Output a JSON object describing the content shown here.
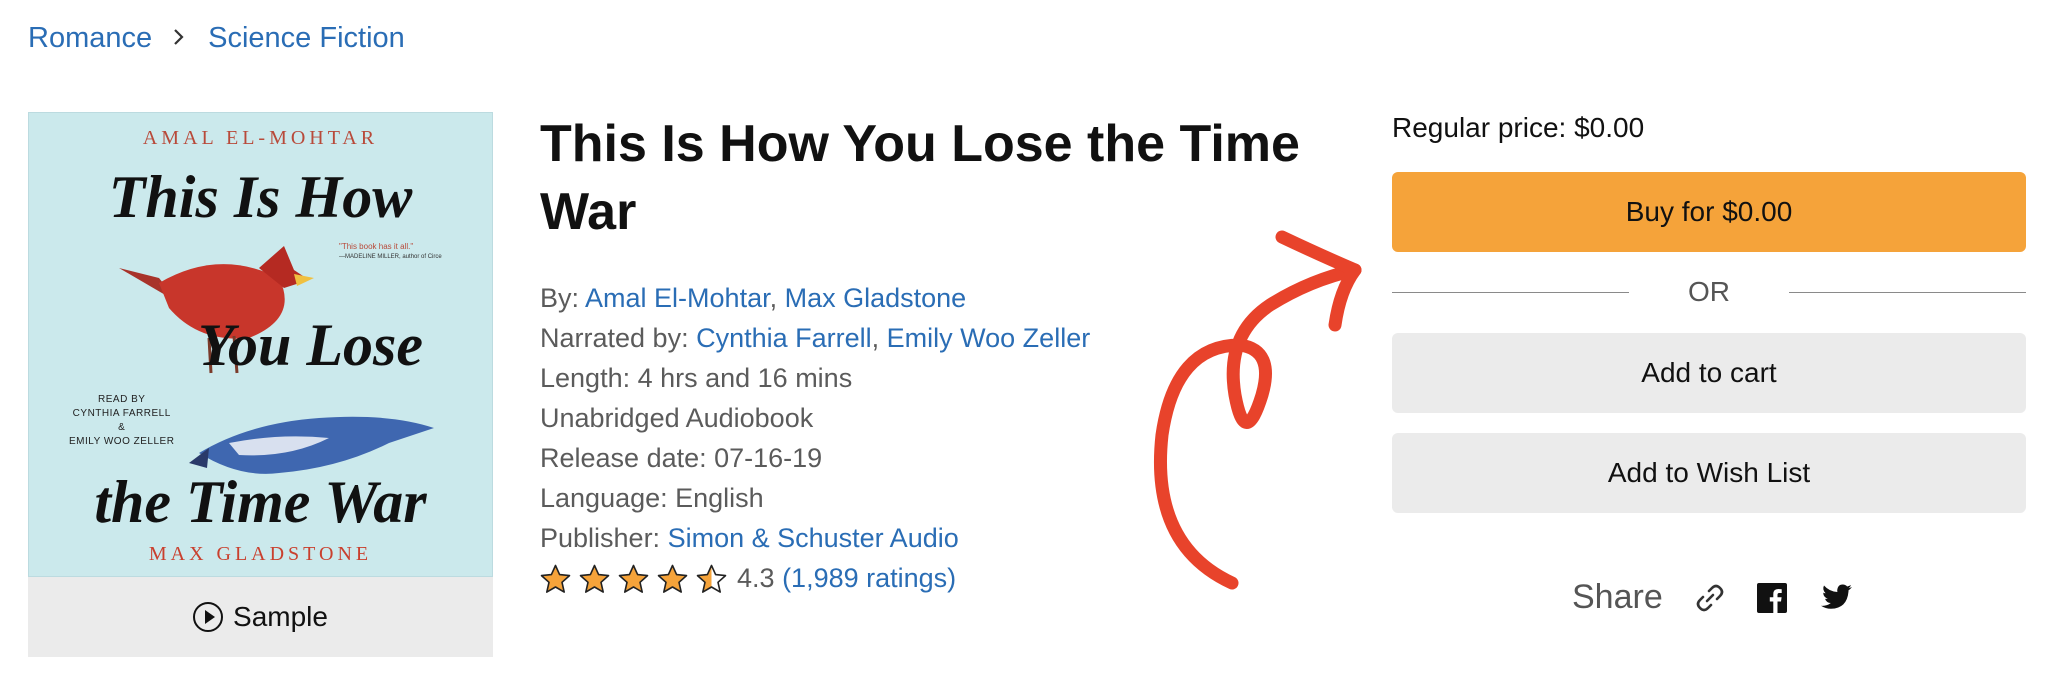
{
  "breadcrumb": {
    "items": [
      "Romance",
      "Science Fiction"
    ]
  },
  "cover": {
    "author_top": "AMAL EL-MOHTAR",
    "title_lines": [
      "This Is How",
      "You Lose",
      "the Time War"
    ],
    "read_by": "READ BY",
    "narrator_1": "CYNTHIA FARRELL",
    "amp": "&",
    "narrator_2": "EMILY WOO ZELLER",
    "quote": "\"This book has it all.\"",
    "quote_attrib": "—MADELINE MILLER, author of Circe",
    "author_bottom": "MAX GLADSTONE"
  },
  "sample": {
    "label": "Sample"
  },
  "book": {
    "title": "This Is How You Lose the Time War",
    "by_label": "By: ",
    "authors": [
      "Amal El-Mohtar",
      "Max Gladstone"
    ],
    "narrated_label": "Narrated by: ",
    "narrators": [
      "Cynthia Farrell",
      "Emily Woo Zeller"
    ],
    "length": "Length: 4 hrs and 16 mins",
    "format": "Unabridged Audiobook",
    "release": "Release date: 07-16-19",
    "language": "Language: English",
    "publisher_label": "Publisher: ",
    "publisher": "Simon & Schuster Audio",
    "rating_value": "4.3",
    "rating_stars": 4.3,
    "ratings_count": "(1,989 ratings)"
  },
  "purchase": {
    "regular_price": "Regular price: $0.00",
    "buy_label": "Buy for $0.00",
    "or_label": "OR",
    "cart_label": "Add to cart",
    "wish_label": "Add to Wish List"
  },
  "share": {
    "label": "Share",
    "icons": [
      "link-icon",
      "facebook-icon",
      "twitter-icon"
    ]
  },
  "colors": {
    "link": "#2a6db5",
    "buy": "#f5a33a",
    "star": "#f5a33a",
    "annotation": "#e8432b"
  }
}
